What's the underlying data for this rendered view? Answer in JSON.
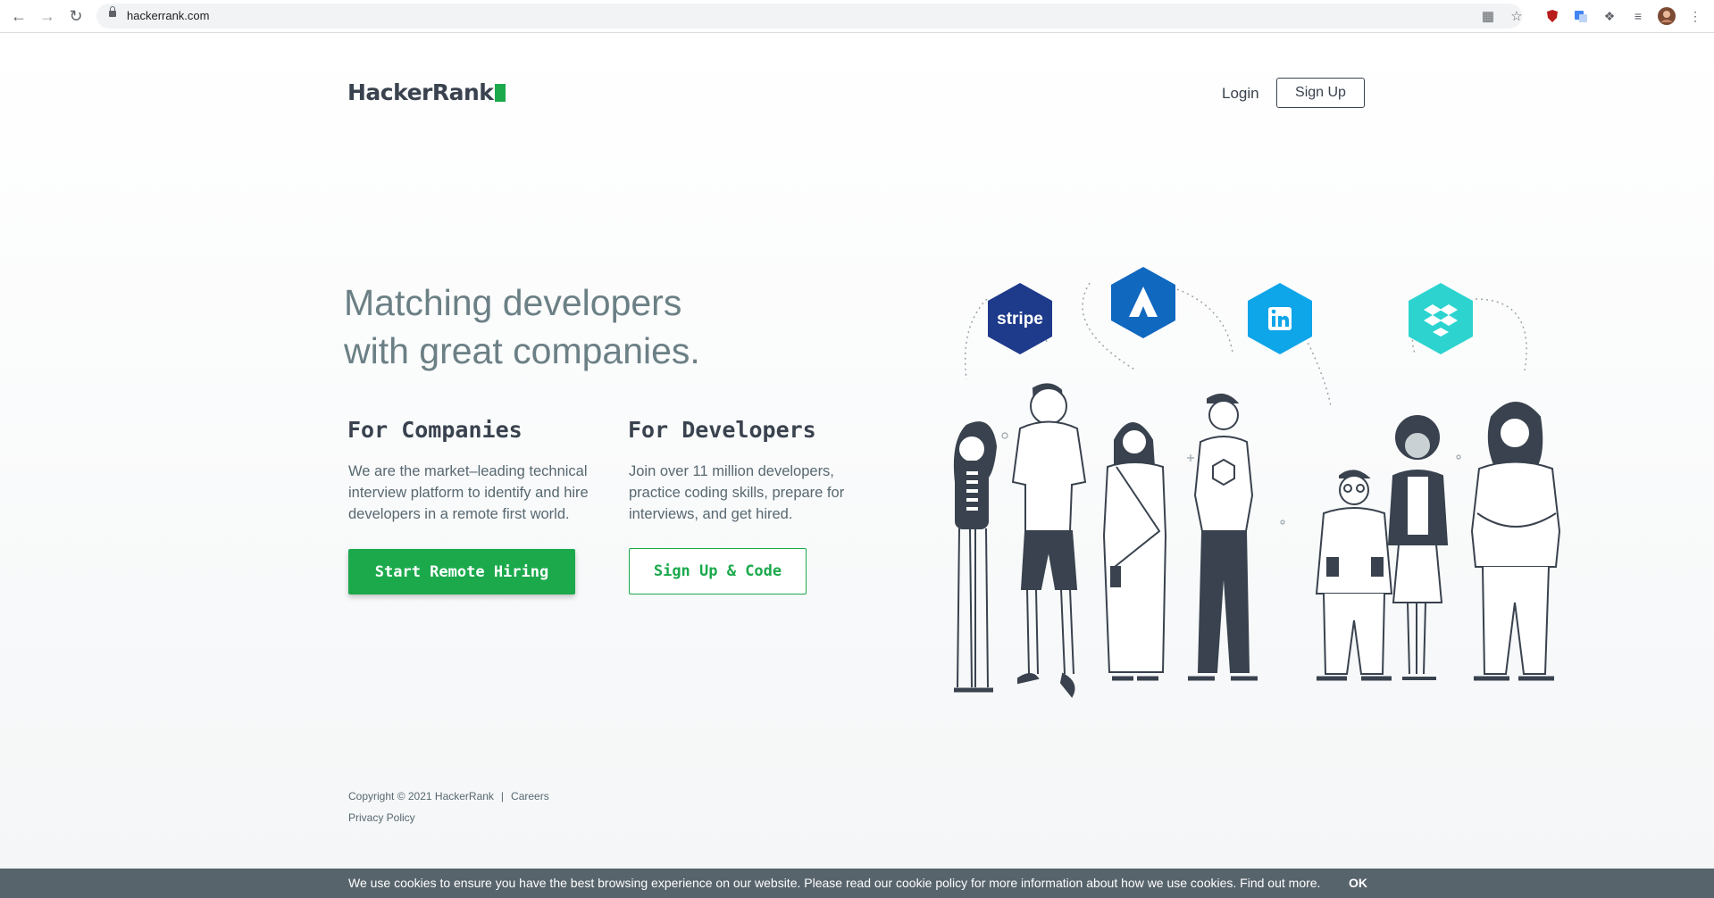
{
  "browser": {
    "url": "hackerrank.com"
  },
  "header": {
    "logo_text": "HackerRank",
    "login_label": "Login",
    "signup_label": "Sign Up"
  },
  "hero": {
    "headline_line1": "Matching developers",
    "headline_line2": "with great companies."
  },
  "companies": {
    "title": "For Companies",
    "text": "We are the market–leading technical interview platform to identify and hire developers  in a remote first world.",
    "button_label": "Start Remote Hiring"
  },
  "developers": {
    "title": "For Developers",
    "text": "Join over 11 million developers, practice coding skills, prepare for interviews, and get hired.",
    "button_label": "Sign Up & Code"
  },
  "partner_logos": {
    "stripe": "stripe",
    "items": [
      "stripe-logo",
      "atlassian-logo",
      "linkedin-logo",
      "dropbox-logo"
    ]
  },
  "footer": {
    "copyright": "Copyright © 2021 HackerRank",
    "separator": "|",
    "careers": "Careers",
    "privacy": "Privacy Policy"
  },
  "cookie_bar": {
    "text": "We use cookies to ensure you have the best browsing experience on our website. Please read our cookie policy for more information about how we use cookies. Find out more.",
    "ok_label": "OK"
  },
  "colors": {
    "brand_green": "#1ba94c",
    "text_dark": "#39424e",
    "stripe_blue": "#1e3a8a",
    "atlassian_blue": "#1068bf",
    "linkedin_blue": "#0ea5e9",
    "dropbox_teal": "#2dd4cf",
    "cookie_bg": "#58646c"
  }
}
